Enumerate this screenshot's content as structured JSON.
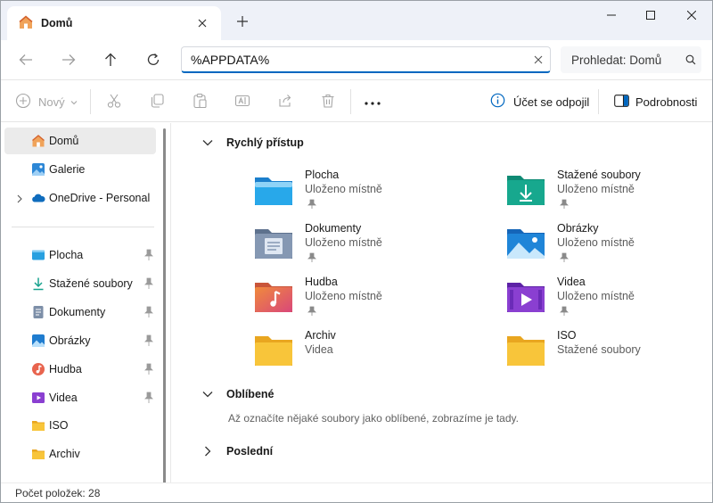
{
  "tab": {
    "title": "Domů"
  },
  "address": {
    "value": "%APPDATA%"
  },
  "search": {
    "placeholder": "Prohledat: Domů"
  },
  "commands": {
    "new_label": "Nový",
    "account_label": "Účet se odpojil",
    "details_label": "Podrobnosti"
  },
  "sidebar": {
    "items": [
      {
        "label": "Domů",
        "icon": "home-icon"
      },
      {
        "label": "Galerie",
        "icon": "gallery-icon"
      },
      {
        "label": "OneDrive - Personal",
        "icon": "onedrive-icon"
      },
      {
        "label": "Plocha",
        "icon": "desktop-folder-icon"
      },
      {
        "label": "Stažené soubory",
        "icon": "downloads-icon"
      },
      {
        "label": "Dokumenty",
        "icon": "documents-icon"
      },
      {
        "label": "Obrázky",
        "icon": "pictures-icon"
      },
      {
        "label": "Hudba",
        "icon": "music-icon"
      },
      {
        "label": "Videa",
        "icon": "videos-icon"
      },
      {
        "label": "ISO",
        "icon": "folder-icon"
      },
      {
        "label": "Archiv",
        "icon": "folder-icon"
      }
    ]
  },
  "quick_access": {
    "title": "Rychlý přístup",
    "items": [
      {
        "name": "Plocha",
        "sub": "Uloženo místně",
        "icon": "desktop-folder-icon"
      },
      {
        "name": "Stažené soubory",
        "sub": "Uloženo místně",
        "icon": "downloads-folder-icon"
      },
      {
        "name": "Dokumenty",
        "sub": "Uloženo místně",
        "icon": "documents-folder-icon"
      },
      {
        "name": "Obrázky",
        "sub": "Uloženo místně",
        "icon": "pictures-folder-icon"
      },
      {
        "name": "Hudba",
        "sub": "Uloženo místně",
        "icon": "music-folder-icon"
      },
      {
        "name": "Videa",
        "sub": "Uloženo místně",
        "icon": "videos-folder-icon"
      },
      {
        "name": "Archiv",
        "sub": "Videa",
        "icon": "folder-icon"
      },
      {
        "name": "ISO",
        "sub": "Stažené soubory",
        "icon": "folder-icon"
      }
    ]
  },
  "favorites": {
    "title": "Oblíbené",
    "empty_message": "Až označíte nějaké soubory jako oblíbené, zobrazíme je tady."
  },
  "recent": {
    "title": "Poslední"
  },
  "status": {
    "item_count": "Počet položek: 28"
  },
  "colors": {
    "accent": "#0067c0",
    "folder_yellow": "#f8c53a"
  }
}
